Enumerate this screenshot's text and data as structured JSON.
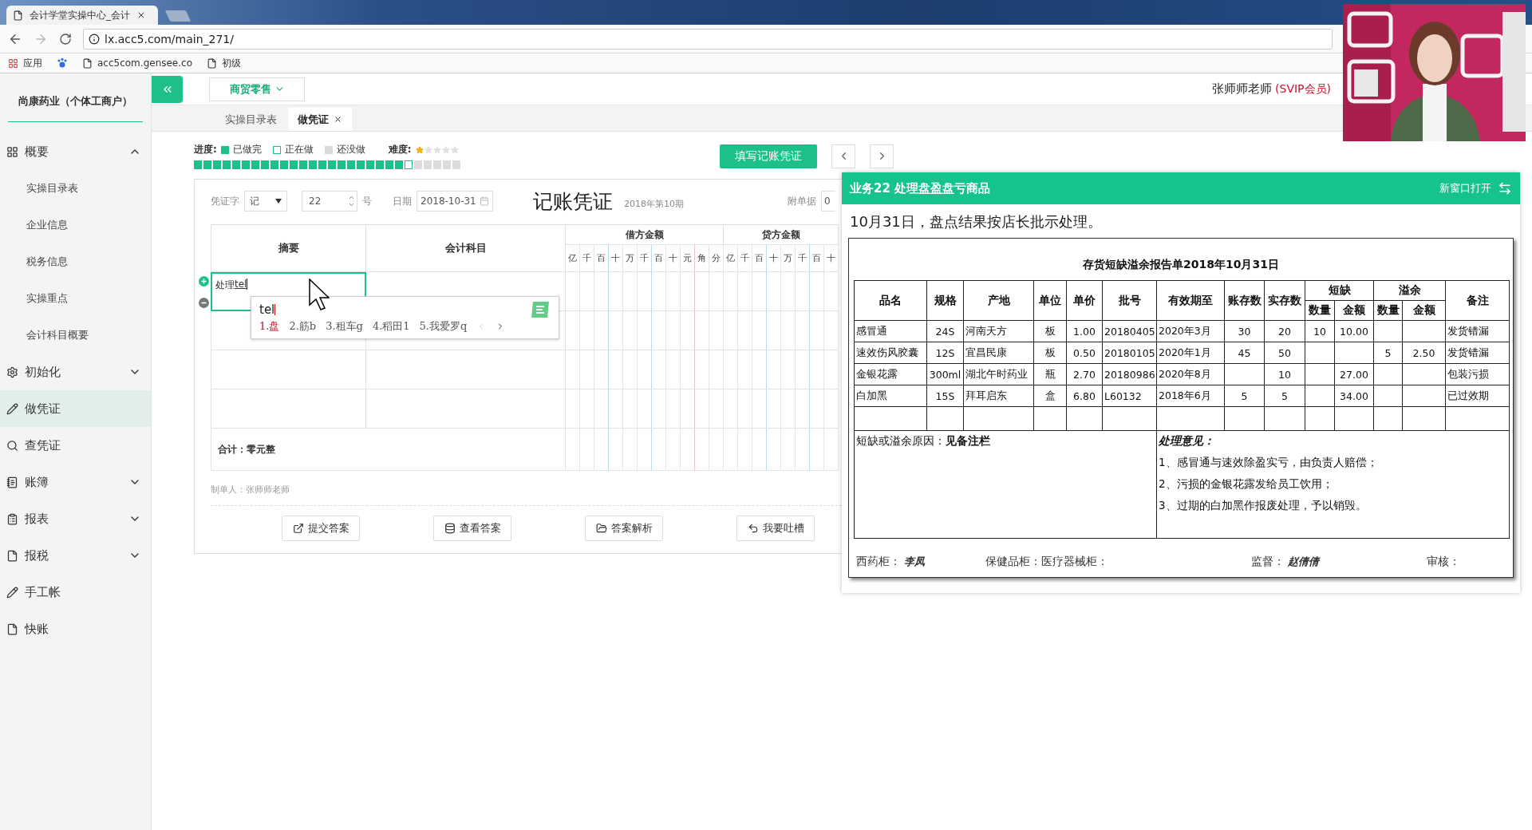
{
  "browser": {
    "tab_title": "会计学堂实操中心_会计",
    "url": "lx.acc5.com/main_271/",
    "bookmarks": [
      {
        "kind": "apps",
        "label": "应用"
      },
      {
        "kind": "paw"
      },
      {
        "kind": "page",
        "label": "acc5com.gensee.co"
      },
      {
        "kind": "page",
        "label": "初级"
      }
    ]
  },
  "sidebar": {
    "company": "尚康药业（个体工商户）",
    "items": [
      {
        "label": "概要",
        "kind": "group",
        "expanded": true,
        "selected": false,
        "children": [
          {
            "label": "实操目录表"
          },
          {
            "label": "企业信息"
          },
          {
            "label": "税务信息"
          },
          {
            "label": "实操重点"
          },
          {
            "label": "会计科目概要"
          }
        ]
      },
      {
        "label": "初始化",
        "kind": "group",
        "expanded": false,
        "selected": false
      },
      {
        "label": "做凭证",
        "kind": "link",
        "selected": true
      },
      {
        "label": "查凭证",
        "kind": "link",
        "selected": false
      },
      {
        "label": "账簿",
        "kind": "group",
        "expanded": false,
        "selected": false
      },
      {
        "label": "报表",
        "kind": "group",
        "expanded": false,
        "selected": false
      },
      {
        "label": "报税",
        "kind": "group",
        "expanded": false,
        "selected": false
      },
      {
        "label": "手工帐",
        "kind": "link",
        "selected": false
      },
      {
        "label": "快账",
        "kind": "link",
        "selected": false
      }
    ]
  },
  "header": {
    "industry": "商贸零售",
    "user": "张师师老师",
    "membership": "(SVIP会员)"
  },
  "tabs": [
    {
      "label": "实操目录表",
      "selected": false,
      "closable": false
    },
    {
      "label": "做凭证",
      "selected": true,
      "closable": true
    }
  ],
  "progress": {
    "label": "进度:",
    "legend": [
      {
        "kind": "done",
        "label": "已做完"
      },
      {
        "kind": "current",
        "label": "正在做"
      },
      {
        "kind": "todo",
        "label": "还没做"
      }
    ],
    "difficulty_label": "难度:",
    "stars": 1,
    "steps": [
      {
        "kind": "done"
      },
      {
        "kind": "done"
      },
      {
        "kind": "done"
      },
      {
        "kind": "done"
      },
      {
        "kind": "done"
      },
      {
        "kind": "done"
      },
      {
        "kind": "done"
      },
      {
        "kind": "done"
      },
      {
        "kind": "done"
      },
      {
        "kind": "done"
      },
      {
        "kind": "done"
      },
      {
        "kind": "done"
      },
      {
        "kind": "done"
      },
      {
        "kind": "done"
      },
      {
        "kind": "done"
      },
      {
        "kind": "done"
      },
      {
        "kind": "done"
      },
      {
        "kind": "done"
      },
      {
        "kind": "done"
      },
      {
        "kind": "done"
      },
      {
        "kind": "done"
      },
      {
        "kind": "done"
      },
      {
        "kind": "current"
      },
      {
        "kind": "todo"
      },
      {
        "kind": "todo"
      },
      {
        "kind": "todo"
      },
      {
        "kind": "todo"
      },
      {
        "kind": "todo"
      }
    ]
  },
  "fill_button": "填写记账凭证",
  "voucher": {
    "word_label": "凭证字",
    "word": "记",
    "number": "22",
    "number_suffix": "号",
    "date_label": "日期",
    "date": "2018-10-31",
    "title": "记账凭证",
    "period": "2018年第10期",
    "attachments_label": "附单据",
    "attachments": "0",
    "columns": {
      "summary": "摘要",
      "account": "会计科目",
      "debit": "借方金额",
      "credit": "贷方金额",
      "debit_units": [
        "亿",
        "千",
        "百",
        "十",
        "万",
        "千",
        "百",
        "十",
        "元",
        "角",
        "分"
      ],
      "credit_units": [
        "亿",
        "千",
        "百",
        "十",
        "万",
        "千",
        "百",
        "十"
      ]
    },
    "rows": [
      {
        "summary": "处理",
        "composition": "tel",
        "active": true
      },
      {
        "active": false
      },
      {
        "active": false
      },
      {
        "active": false
      }
    ],
    "total": "合计：零元整",
    "maker": "制单人：张师师老师",
    "actions": [
      "提交答案",
      "查看答案",
      "答案解析",
      "我要吐槽"
    ]
  },
  "ime": {
    "input": "tel",
    "candidates": [
      {
        "label": "1.盘",
        "selected": true
      },
      {
        "label": "2.筋b",
        "selected": false
      },
      {
        "label": "3.租车g",
        "selected": false
      },
      {
        "label": "4.稻田1",
        "selected": false
      },
      {
        "label": "5.我爱罗q",
        "selected": false
      }
    ]
  },
  "task": {
    "title": "业务22 处理盘盈盘亏商品",
    "open_new": "新窗口打开",
    "description": "10月31日，盘点结果按店长批示处理。",
    "report": {
      "title": "存货短缺溢余报告单2018年10月31日",
      "headers": [
        "品名",
        "规格",
        "产地",
        "单位",
        "单价",
        "批号",
        "有效期至",
        "账存数",
        "实存数"
      ],
      "groups": [
        {
          "label": "短缺",
          "sub": [
            "数量",
            "金额"
          ]
        },
        {
          "label": "溢余",
          "sub": [
            "数量",
            "金额"
          ]
        }
      ],
      "remark_header": "备注",
      "rows": [
        [
          "感冒通",
          "24S",
          "河南天方",
          "板",
          "1.00",
          "20180405",
          "2020年3月",
          "30",
          "20",
          "10",
          "10.00",
          null,
          null,
          "发货错漏"
        ],
        [
          "速效伤风胶囊",
          "12S",
          "宜昌民康",
          "板",
          "0.50",
          "20180105",
          "2020年1月",
          "45",
          "50",
          null,
          null,
          "5",
          "2.50",
          "发货错漏"
        ],
        [
          "金银花露",
          "300ml",
          "湖北午时药业",
          "瓶",
          "2.70",
          "20180986",
          "2020年8月",
          null,
          "10",
          null,
          "27.00",
          null,
          null,
          "包装污损"
        ],
        [
          "白加黑",
          "15S",
          "拜耳启东",
          "盒",
          "6.80",
          "L60132",
          "2018年6月",
          "5",
          "5",
          null,
          "34.00",
          null,
          null,
          "已过效期"
        ]
      ],
      "reason": "短缺或溢余原因：**见备注栏**",
      "opinion_title": "处理意见：",
      "opinions": [
        "1、感冒通与速效除盈实亏，由负责人赔偿；",
        "2、污损的金银花露发给员工饮用；",
        "3、过期的白加黑作报废处理，予以销毁。"
      ],
      "signatures": [
        {
          "label": "西药柜：",
          "signature": "李凤"
        },
        {
          "label": "保健品柜：医疗器械柜："
        },
        {
          "label": "监督：",
          "signature": "赵倩倩"
        },
        {
          "label": "审核："
        }
      ]
    }
  }
}
